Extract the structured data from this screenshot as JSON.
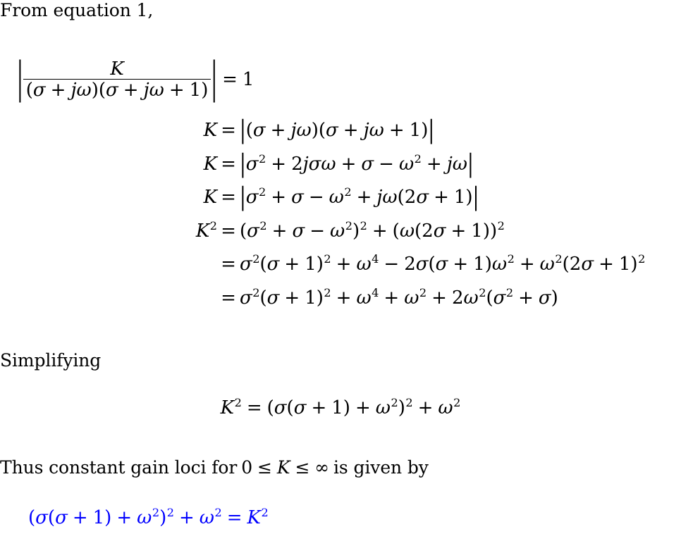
{
  "document": {
    "type": "math-derivation",
    "title_text": "From equation 1,",
    "accent_color": "#0000ff",
    "text_color": "#000000",
    "background_color": "#ffffff"
  },
  "prose": {
    "intro": "From equation 1,",
    "simplifying": "Simplifying",
    "thus_prefix": "Thus constant gain loci for",
    "thus_range": "0 ≤ K ≤ ∞",
    "thus_suffix": "is given by"
  },
  "equations": {
    "fraction_equation": {
      "label": "eq-fraction",
      "numerator": "K",
      "denominator": "(σ + jω)(σ + jω + 1)",
      "abs_open": "|",
      "abs_close": "|",
      "equals": "=",
      "rhs": "1",
      "plain": "|K / ((σ + jω)(σ + jω + 1))| = 1"
    },
    "align_rows": [
      {
        "lhs": "K",
        "lhs_exponent": "",
        "relation": "=",
        "rhs_plain": "|(σ + jω)(σ + jω + 1)|"
      },
      {
        "lhs": "K",
        "lhs_exponent": "",
        "relation": "=",
        "rhs_plain": "|σ² + 2jσω + σ − ω² + jω|"
      },
      {
        "lhs": "K",
        "lhs_exponent": "",
        "relation": "=",
        "rhs_plain": "|σ² + σ − ω² + jω(2σ + 1)|"
      },
      {
        "lhs": "K",
        "lhs_exponent": "2",
        "relation": "=",
        "rhs_plain": "(σ² + σ − ω²)² + (ω(2σ + 1))²"
      },
      {
        "lhs": "",
        "lhs_exponent": "",
        "relation": "=",
        "rhs_plain": "σ²(σ + 1)² + ω⁴ − 2σ(σ + 1)ω² + ω²(2σ + 1)²"
      },
      {
        "lhs": "",
        "lhs_exponent": "",
        "relation": "=",
        "rhs_plain": "σ²(σ + 1)² + ω⁴ + ω² + 2ω²(σ² + σ)"
      }
    ],
    "simplified_equation": {
      "label": "eq-simplified",
      "plain": "K² = (σ(σ + 1) + ω²)² + ω²"
    },
    "result_equation": {
      "label": "eq-result",
      "color": "#0000ff",
      "plain": "(σ(σ + 1) + ω²)² + ω² = K²"
    }
  },
  "symbols": {
    "sigma": "σ",
    "omega": "ω",
    "j": "j",
    "K": "K",
    "infinity": "∞",
    "leq": "≤",
    "plus": "+",
    "minus": "−",
    "equals": "=",
    "abs": "|",
    "paren_open": "(",
    "paren_close": ")"
  }
}
